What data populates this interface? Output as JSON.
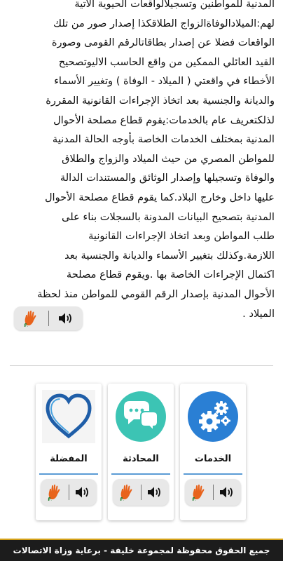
{
  "article": {
    "lines": [
      "المدنية للمواطنين وتسجيلالواقعات الحيوية الاتية",
      "لهم:الميلادالوفاةالزواج الطلاقكذا إصدار صور من تلك",
      "الواقعات فضلا عن إصدار بطاقاتالرقم القومى وصورة",
      "القيد العائلي الممكين من واقع الحاسب الاليوتصحيح",
      "الأخطاء في واقعتي ( الميلاد - الوفاة ) وتغيير الأسماء",
      "والديانة والجنسية بعد اتخاذ الإجراءات القانونية المقررة",
      "لذلكتعريف عام بالخدمات:يقوم قطاع مصلحة الأحوال",
      "المدنية بمختلف الخدمات الخاصة بأوجه الحالة المدنية",
      "للمواطن المصري من حيث الميلاد والزواج والطلاق",
      "والوفاة وتسجيلها وإصدار الوثائق والمستندات الدالة",
      "عليها داخل وخارج البلاد.كما يقوم قطاع مصلحة الأحوال",
      "المدنية بتصحيح البيانات المدونة بالسجلات بناء على",
      "طلب المواطن وبعد اتخاذ الإجراءات القانونية",
      "اللازمة.وكذلك بتغيير الأسماء والديانة والجنسية بعد",
      "اكتمال الإجراءات الخاصة بها .ويقوم قطاع مصلحة",
      "الأحوال المدنية بإصدار الرقم القومي للمواطن منذ لحظة",
      "الميلاد ."
    ]
  },
  "cards": [
    {
      "label": "الخدمات",
      "icon": "gears-icon",
      "color": "#2a7fd4"
    },
    {
      "label": "المحادثة",
      "icon": "chat-bubbles-icon",
      "color": "#3cc4b4"
    },
    {
      "label": "المفضلة",
      "icon": "heart-icon",
      "color": "#1f5ea8"
    }
  ],
  "footer": {
    "text": "جميع الحقوق محفوظة لمجموعة خليفة - برعاية وزاة الاتصالات"
  },
  "colors": {
    "accent_blue": "#5b9bd5",
    "footer_bg": "#1c1c1c",
    "footer_border": "#d4a017",
    "sign_hand": "#e8631c"
  }
}
